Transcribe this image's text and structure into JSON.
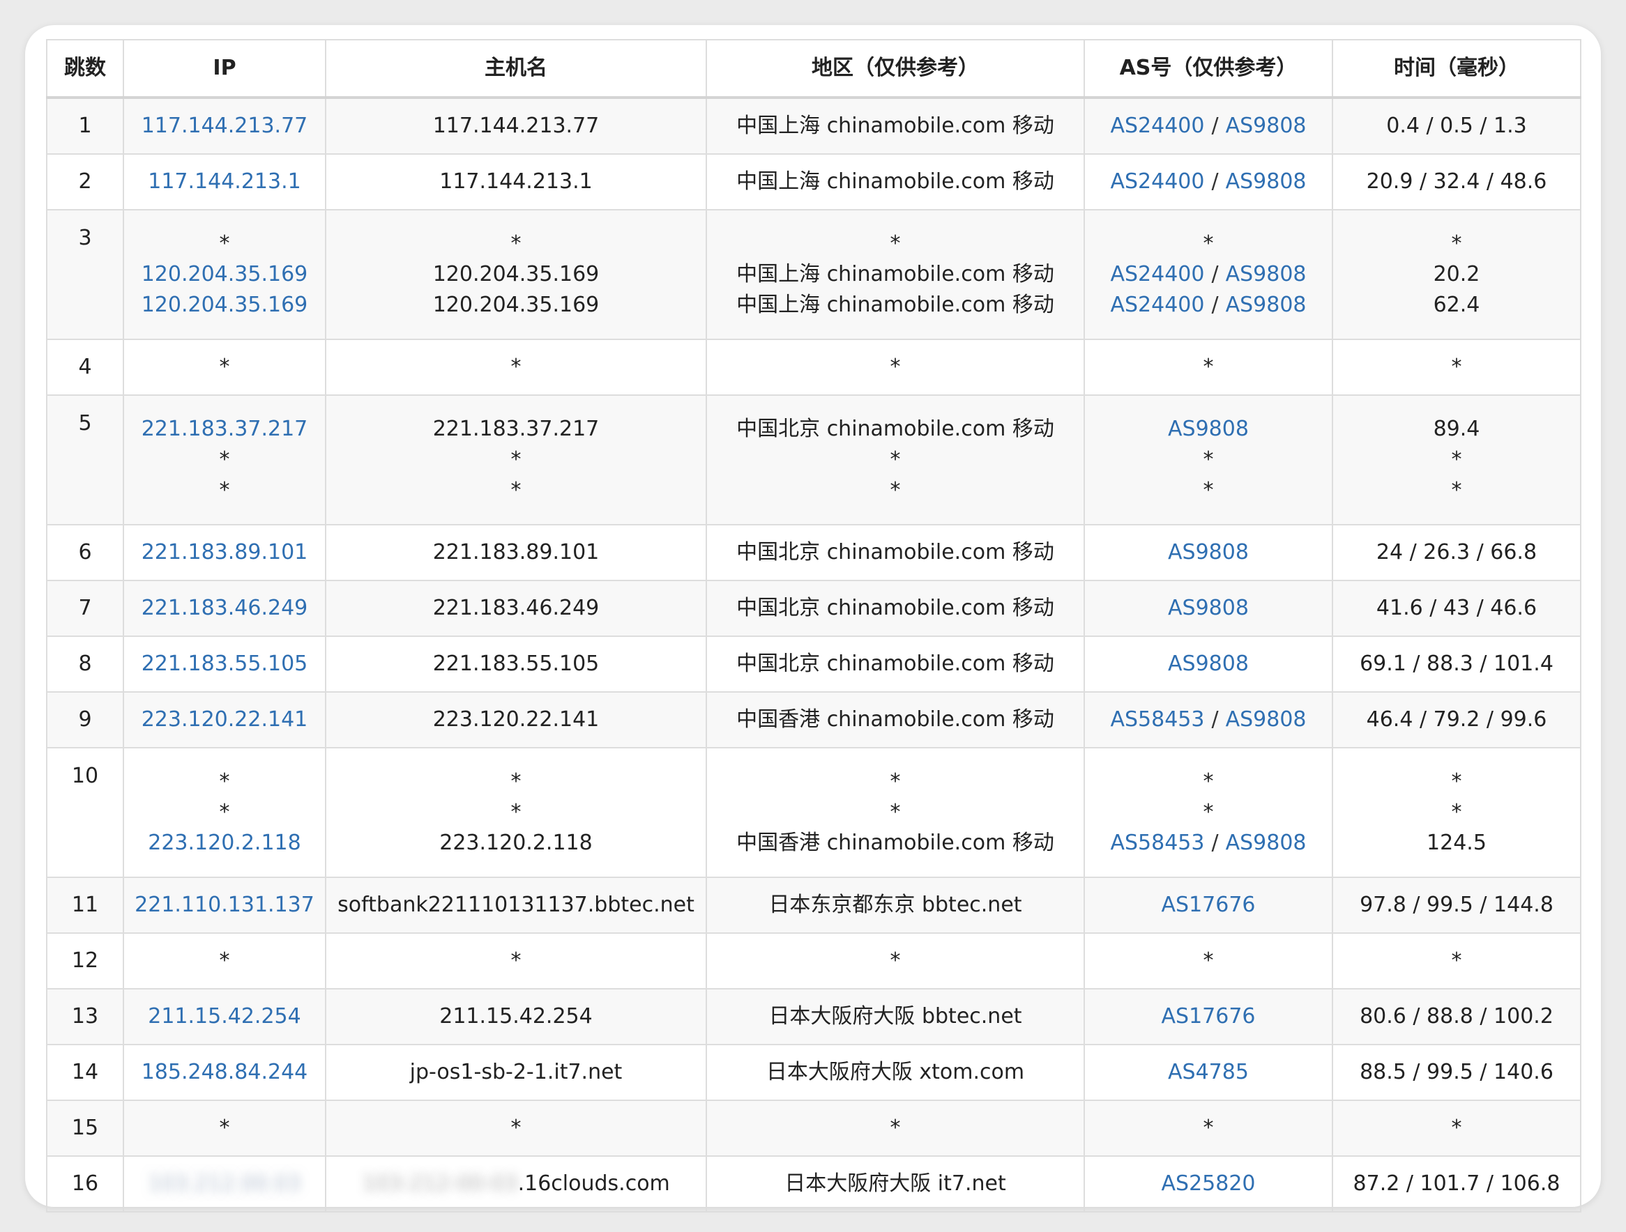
{
  "headers": [
    "跳数",
    "IP",
    "主机名",
    "地区（仅供参考）",
    "AS号（仅供参考）",
    "时间（毫秒）"
  ],
  "colors": {
    "link": "#2f6fb2",
    "border": "#dddddd",
    "stripe": "#f8f8f8"
  },
  "rows": [
    {
      "hop": "1",
      "entries": [
        {
          "ip": "117.144.213.77",
          "host": "117.144.213.77",
          "region": "中国上海 chinamobile.com 移动",
          "as": [
            "AS24400",
            "AS9808"
          ],
          "time": "0.4 / 0.5 / 1.3"
        }
      ]
    },
    {
      "hop": "2",
      "entries": [
        {
          "ip": "117.144.213.1",
          "host": "117.144.213.1",
          "region": "中国上海 chinamobile.com 移动",
          "as": [
            "AS24400",
            "AS9808"
          ],
          "time": "20.9 / 32.4 / 48.6"
        }
      ]
    },
    {
      "hop": "3",
      "entries": [
        {
          "ip": "*",
          "host": "*",
          "region": "*",
          "as": [
            "*"
          ],
          "time": "*"
        },
        {
          "ip": "120.204.35.169",
          "host": "120.204.35.169",
          "region": "中国上海 chinamobile.com 移动",
          "as": [
            "AS24400",
            "AS9808"
          ],
          "time": "20.2"
        },
        {
          "ip": "120.204.35.169",
          "host": "120.204.35.169",
          "region": "中国上海 chinamobile.com 移动",
          "as": [
            "AS24400",
            "AS9808"
          ],
          "time": "62.4"
        }
      ]
    },
    {
      "hop": "4",
      "entries": [
        {
          "ip": "*",
          "host": "*",
          "region": "*",
          "as": [
            "*"
          ],
          "time": "*"
        }
      ]
    },
    {
      "hop": "5",
      "entries": [
        {
          "ip": "221.183.37.217",
          "host": "221.183.37.217",
          "region": "中国北京 chinamobile.com 移动",
          "as": [
            "AS9808"
          ],
          "time": "89.4"
        },
        {
          "ip": "*",
          "host": "*",
          "region": "*",
          "as": [
            "*"
          ],
          "time": "*"
        },
        {
          "ip": "*",
          "host": "*",
          "region": "*",
          "as": [
            "*"
          ],
          "time": "*"
        }
      ]
    },
    {
      "hop": "6",
      "entries": [
        {
          "ip": "221.183.89.101",
          "host": "221.183.89.101",
          "region": "中国北京 chinamobile.com 移动",
          "as": [
            "AS9808"
          ],
          "time": "24 / 26.3 / 66.8"
        }
      ]
    },
    {
      "hop": "7",
      "entries": [
        {
          "ip": "221.183.46.249",
          "host": "221.183.46.249",
          "region": "中国北京 chinamobile.com 移动",
          "as": [
            "AS9808"
          ],
          "time": "41.6 / 43 / 46.6"
        }
      ]
    },
    {
      "hop": "8",
      "entries": [
        {
          "ip": "221.183.55.105",
          "host": "221.183.55.105",
          "region": "中国北京 chinamobile.com 移动",
          "as": [
            "AS9808"
          ],
          "time": "69.1 / 88.3 / 101.4"
        }
      ]
    },
    {
      "hop": "9",
      "entries": [
        {
          "ip": "223.120.22.141",
          "host": "223.120.22.141",
          "region": "中国香港 chinamobile.com 移动",
          "as": [
            "AS58453",
            "AS9808"
          ],
          "time": "46.4 / 79.2 / 99.6"
        }
      ]
    },
    {
      "hop": "10",
      "entries": [
        {
          "ip": "*",
          "host": "*",
          "region": "*",
          "as": [
            "*"
          ],
          "time": "*"
        },
        {
          "ip": "*",
          "host": "*",
          "region": "*",
          "as": [
            "*"
          ],
          "time": "*"
        },
        {
          "ip": "223.120.2.118",
          "host": "223.120.2.118",
          "region": "中国香港 chinamobile.com 移动",
          "as": [
            "AS58453",
            "AS9808"
          ],
          "time": "124.5"
        }
      ]
    },
    {
      "hop": "11",
      "entries": [
        {
          "ip": "221.110.131.137",
          "host": "softbank221110131137.bbtec.net",
          "region": "日本东京都东京 bbtec.net",
          "as": [
            "AS17676"
          ],
          "time": "97.8 / 99.5 / 144.8"
        }
      ]
    },
    {
      "hop": "12",
      "entries": [
        {
          "ip": "*",
          "host": "*",
          "region": "*",
          "as": [
            "*"
          ],
          "time": "*"
        }
      ]
    },
    {
      "hop": "13",
      "entries": [
        {
          "ip": "211.15.42.254",
          "host": "211.15.42.254",
          "region": "日本大阪府大阪 bbtec.net",
          "as": [
            "AS17676"
          ],
          "time": "80.6 / 88.8 / 100.2"
        }
      ]
    },
    {
      "hop": "14",
      "entries": [
        {
          "ip": "185.248.84.244",
          "host": "jp-os1-sb-2-1.it7.net",
          "region": "日本大阪府大阪 xtom.com",
          "as": [
            "AS4785"
          ],
          "time": "88.5 / 99.5 / 140.6"
        }
      ]
    },
    {
      "hop": "15",
      "entries": [
        {
          "ip": "*",
          "host": "*",
          "region": "*",
          "as": [
            "*"
          ],
          "time": "*"
        }
      ]
    },
    {
      "hop": "16",
      "entries": [
        {
          "ip": "103.212.00.03",
          "ip_blurred": true,
          "host_blurred_prefix": "103-212-00-03",
          "host": ".16clouds.com",
          "region": "日本大阪府大阪 it7.net",
          "as": [
            "AS25820"
          ],
          "time": "87.2 / 101.7 / 106.8"
        }
      ]
    }
  ]
}
